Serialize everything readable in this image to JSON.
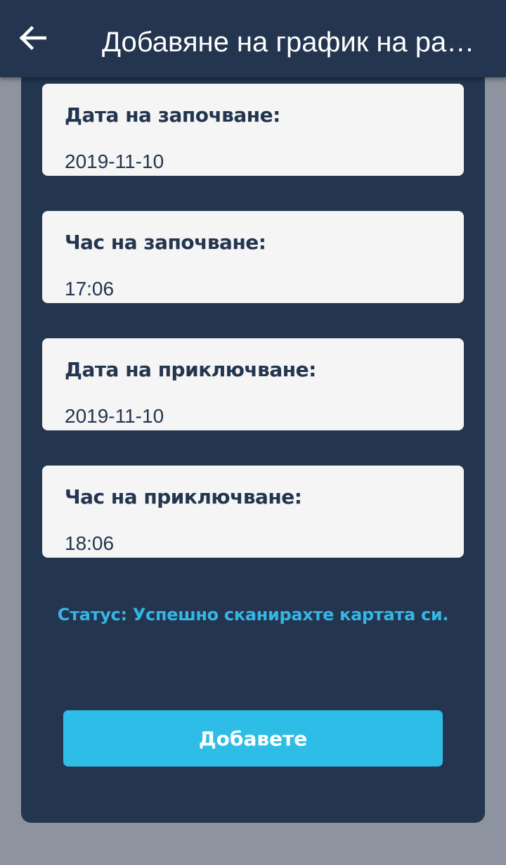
{
  "app_bar": {
    "back_icon": "arrow-left-icon",
    "title": "Добавяне на график на работа"
  },
  "fields": [
    {
      "label": "Дата на започване:",
      "value": "2019-11-10"
    },
    {
      "label": "Час на започване:",
      "value": "17:06"
    },
    {
      "label": "Дата на приключване:",
      "value": "2019-11-10"
    },
    {
      "label": "Час на приключване:",
      "value": "18:06"
    }
  ],
  "status": {
    "text": "Статус: Успешно сканирахте картата си."
  },
  "actions": {
    "add_label": "Добавете"
  },
  "colors": {
    "app_bar": "#23354f",
    "page_background": "#8e949f",
    "card": "#f5f5f5",
    "status_text": "#35b6e4",
    "button": "#2ebde6"
  }
}
